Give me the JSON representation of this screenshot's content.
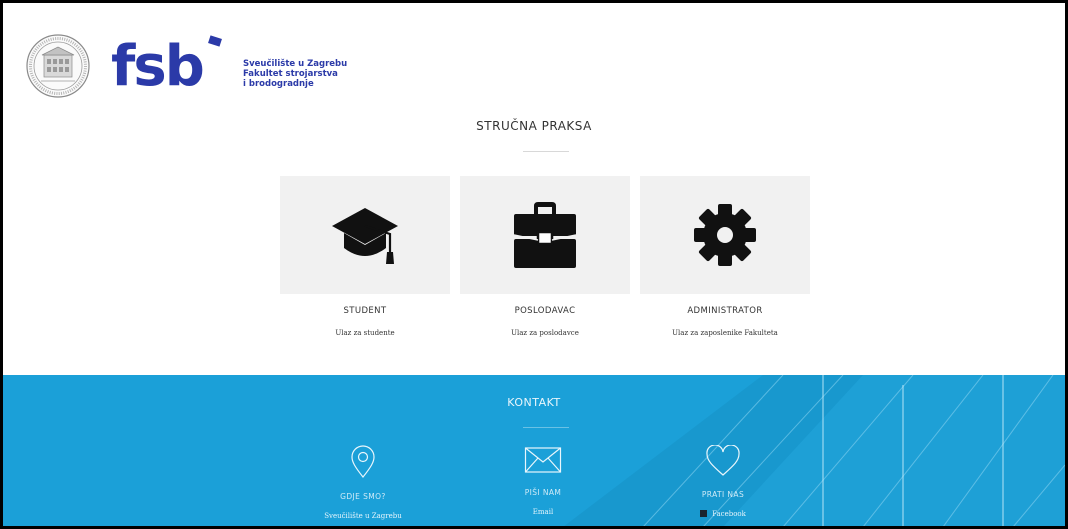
{
  "header": {
    "logo_text": "fsb",
    "university_lines": [
      "Sveučilište u Zagrebu",
      "Fakultet strojarstva",
      "i brodogradnje"
    ]
  },
  "main": {
    "title": "STRUČNA PRAKSA",
    "cards": [
      {
        "title": "STUDENT",
        "subtitle": "Ulaz za studente",
        "icon": "graduation-cap-icon"
      },
      {
        "title": "POSLODAVAC",
        "subtitle": "Ulaz za poslodavce",
        "icon": "briefcase-icon"
      },
      {
        "title": "ADMINISTRATOR",
        "subtitle": "Ulaz za zaposlenike Fakulteta",
        "icon": "gear-icon"
      }
    ]
  },
  "footer": {
    "title": "KONTAKT",
    "columns": [
      {
        "label": "GDJE SMO?",
        "value": "Sveučilište u Zagrebu",
        "icon": "location-pin-icon"
      },
      {
        "label": "PIŠI NAM",
        "value": "Email",
        "icon": "envelope-icon"
      },
      {
        "label": "PRATI NAS",
        "value": "Facebook",
        "icon": "heart-icon"
      }
    ]
  },
  "colors": {
    "brand_blue": "#2b3aa8",
    "footer_blue": "#1ba0d8",
    "card_bg": "#f1f1f1"
  }
}
